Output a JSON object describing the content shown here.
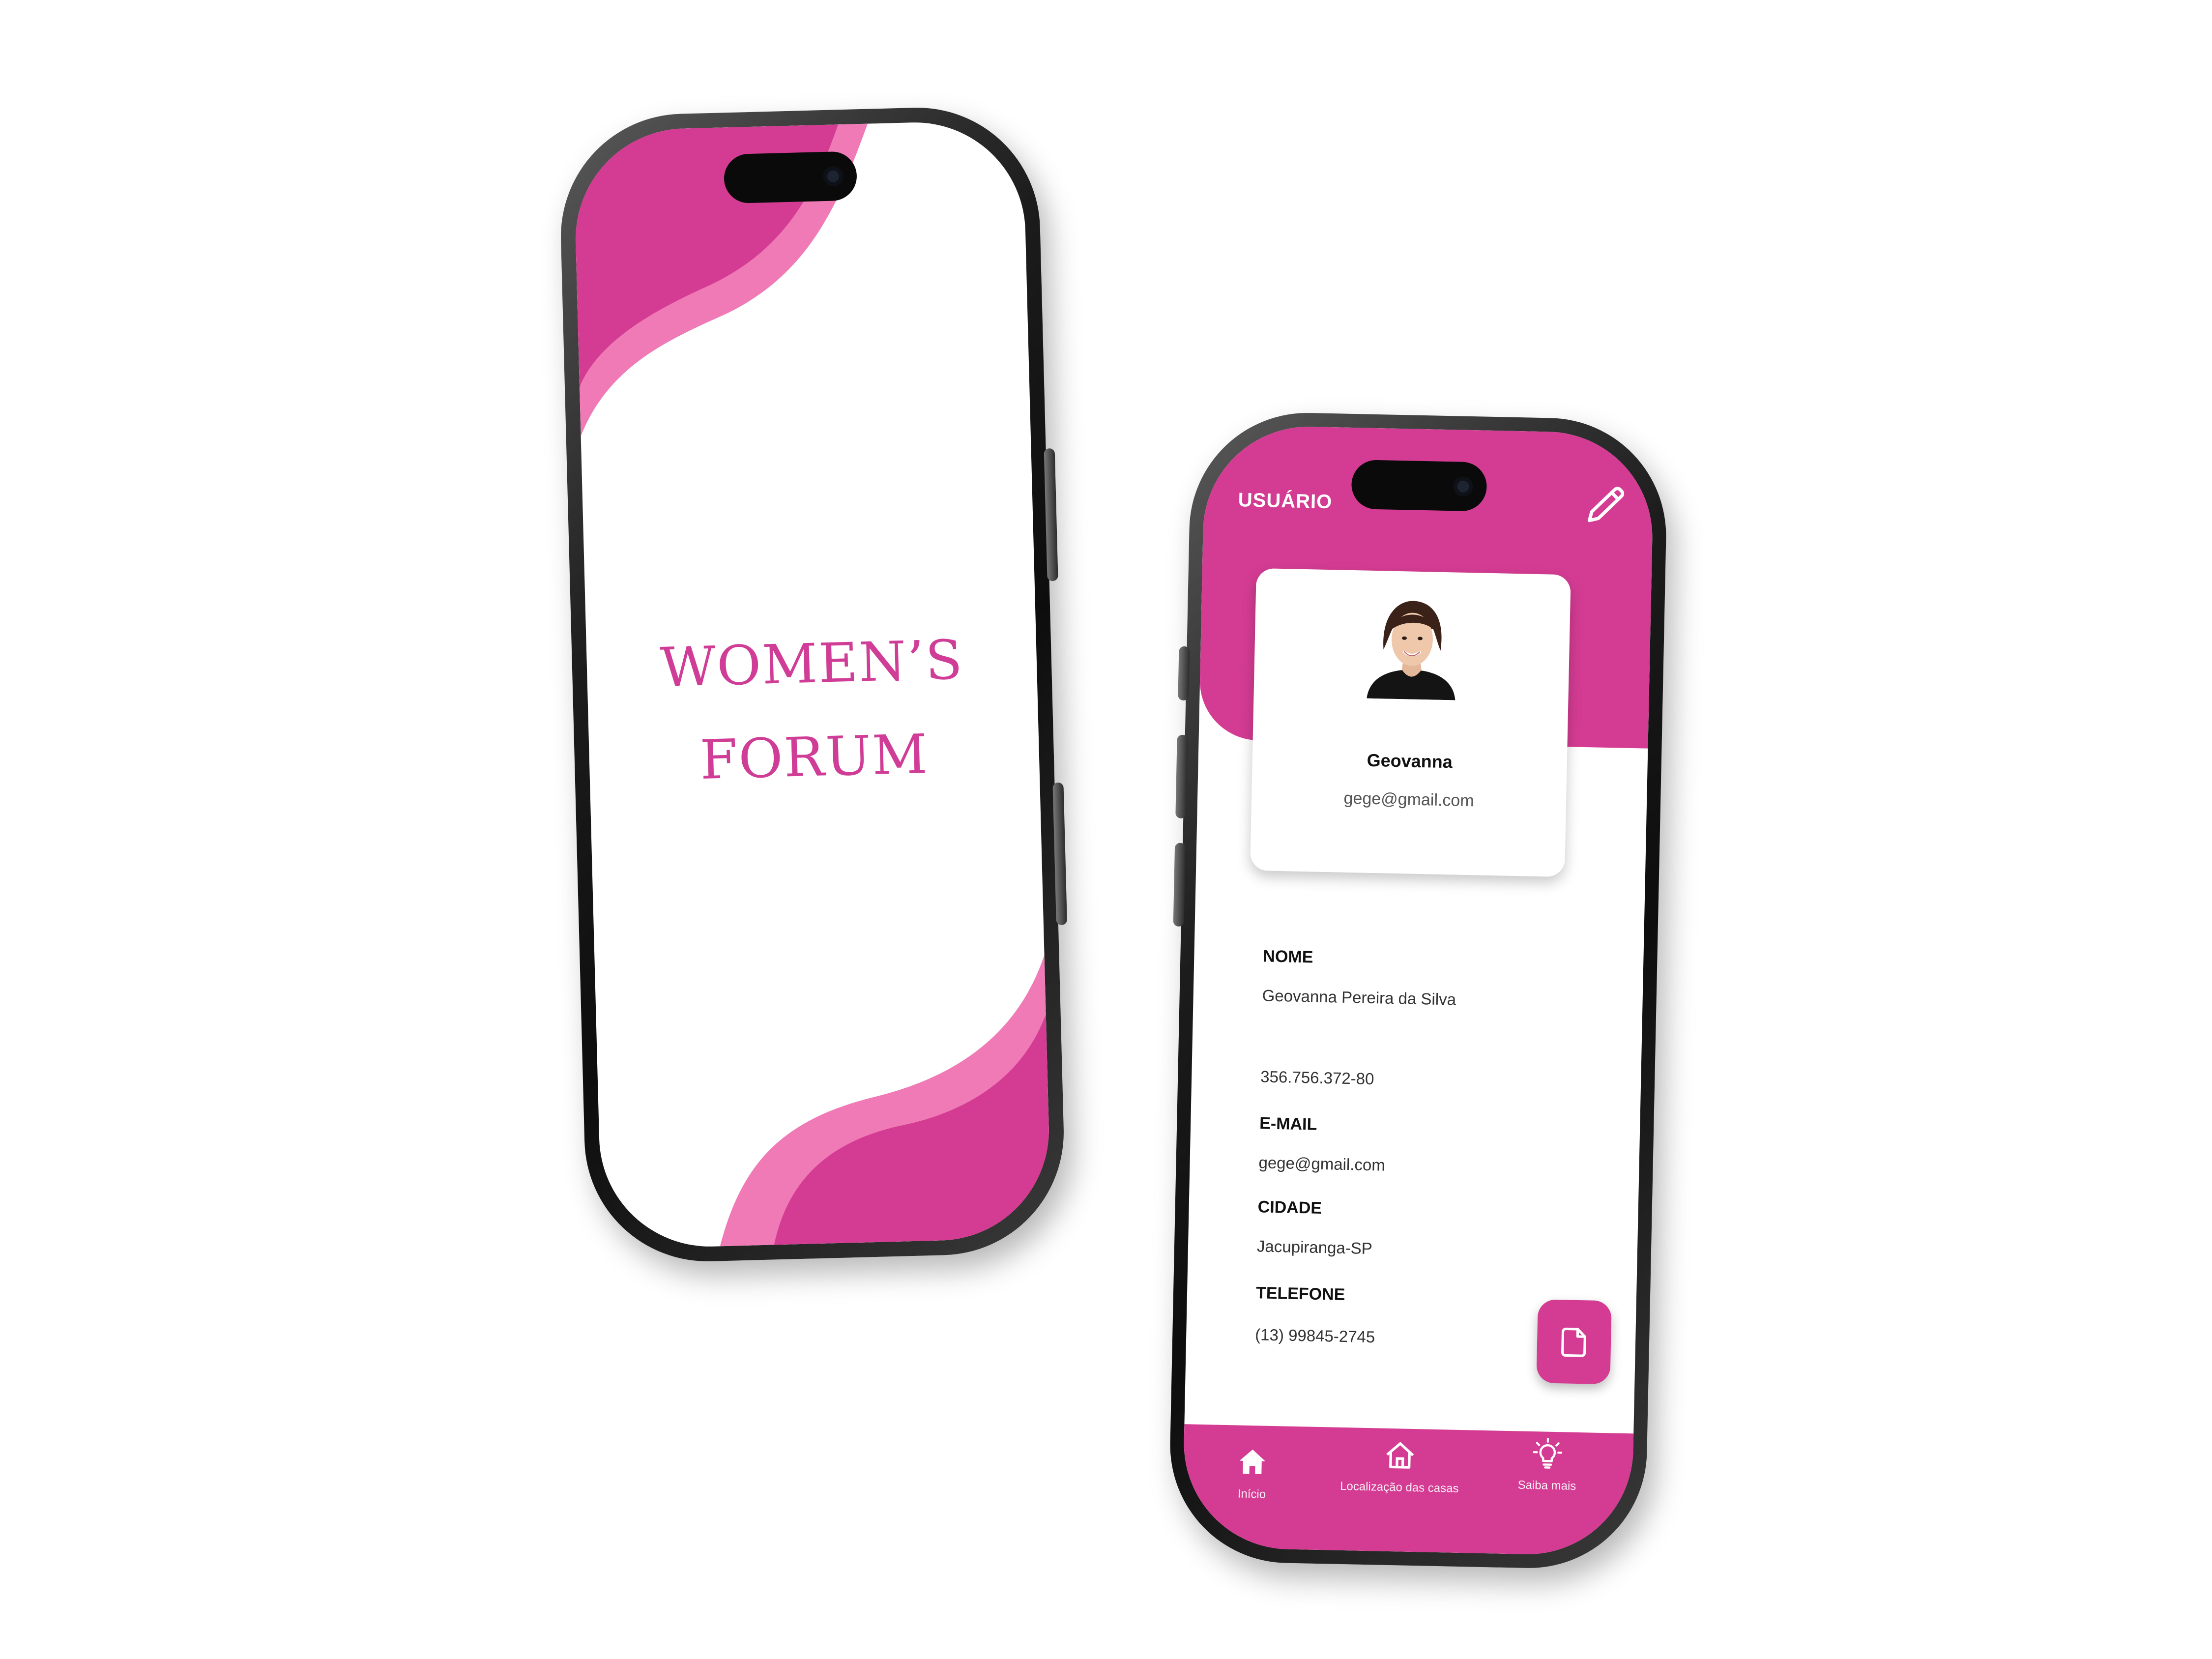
{
  "splash": {
    "title_line1": "WOMEN’S",
    "title_line2": "FORUM"
  },
  "profile": {
    "header_title": "USUÁRIO",
    "card": {
      "name": "Geovanna",
      "email": "gege@gmail.com"
    },
    "fields": [
      {
        "label": "NOME",
        "value": "Geovanna Pereira da Silva"
      },
      {
        "label": "",
        "value": "356.756.372-80"
      },
      {
        "label": "E-MAIL",
        "value": "gege@gmail.com"
      },
      {
        "label": "CIDADE",
        "value": "Jacupiranga-SP"
      },
      {
        "label": "TELEFONE",
        "value": "(13) 99845-2745"
      }
    ],
    "nav": [
      {
        "label": "Início",
        "icon": "home-filled-icon"
      },
      {
        "label": "Localização das casas",
        "icon": "home-outline-icon"
      },
      {
        "label": "Saiba mais",
        "icon": "lightbulb-icon"
      }
    ]
  },
  "colors": {
    "brand_pink": "#d43c93",
    "light_pink": "#ef7ab6",
    "title_pink": "#d03d96"
  }
}
